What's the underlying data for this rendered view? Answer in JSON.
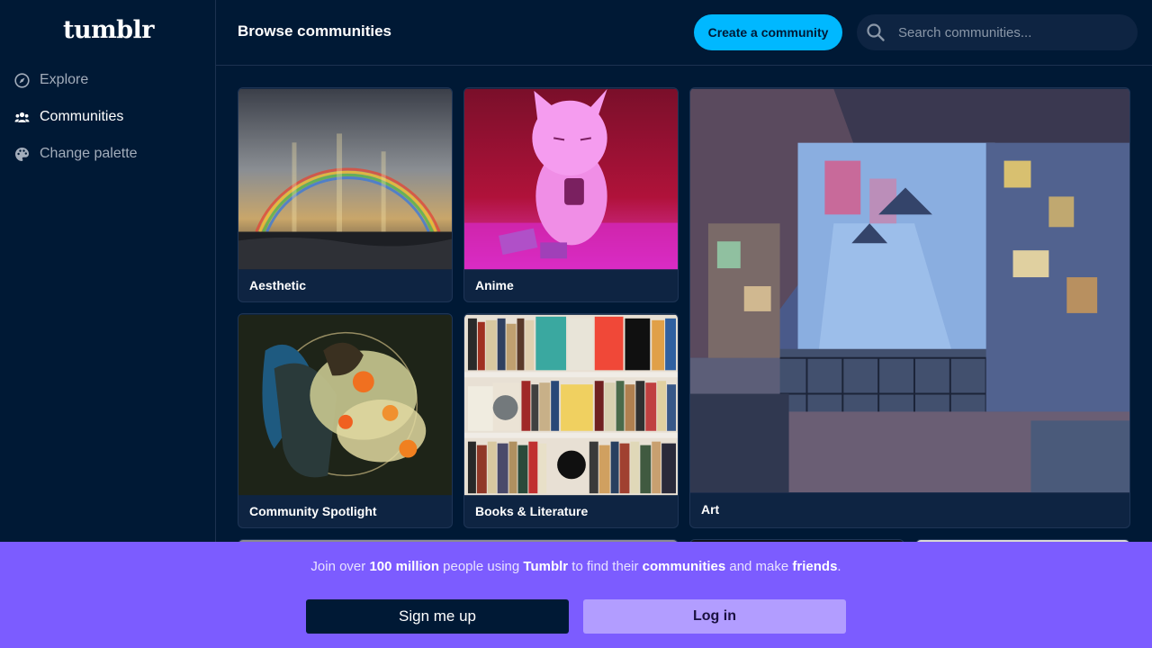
{
  "app": {
    "logo": "tumblr"
  },
  "sidebar": {
    "items": [
      {
        "label": "Explore",
        "icon": "compass-icon"
      },
      {
        "label": "Communities",
        "icon": "people-icon"
      },
      {
        "label": "Change palette",
        "icon": "palette-icon"
      }
    ]
  },
  "header": {
    "title": "Browse communities",
    "create_label": "Create a community",
    "search_placeholder": "Search communities..."
  },
  "communities": [
    {
      "name": "Aesthetic",
      "image": "rainbow-seascape"
    },
    {
      "name": "Anime",
      "image": "pink-cat-anime"
    },
    {
      "name": "Art",
      "image": "illustrated-cluttered-room"
    },
    {
      "name": "Community Spotlight",
      "image": "embracing-couple-illustration"
    },
    {
      "name": "Books & Literature",
      "image": "bookshelf"
    }
  ],
  "banner": {
    "text_parts": {
      "p1": "Join over ",
      "b1": "100 million",
      "p2": " people using ",
      "b2": "Tumblr",
      "p3": " to find their ",
      "b3": "communities",
      "p4": " and make ",
      "b4": "friends",
      "p5": "."
    },
    "signup_label": "Sign me up",
    "login_label": "Log in"
  },
  "colors": {
    "background": "#001935",
    "accent": "#00b8ff",
    "banner": "#7c5cff"
  }
}
